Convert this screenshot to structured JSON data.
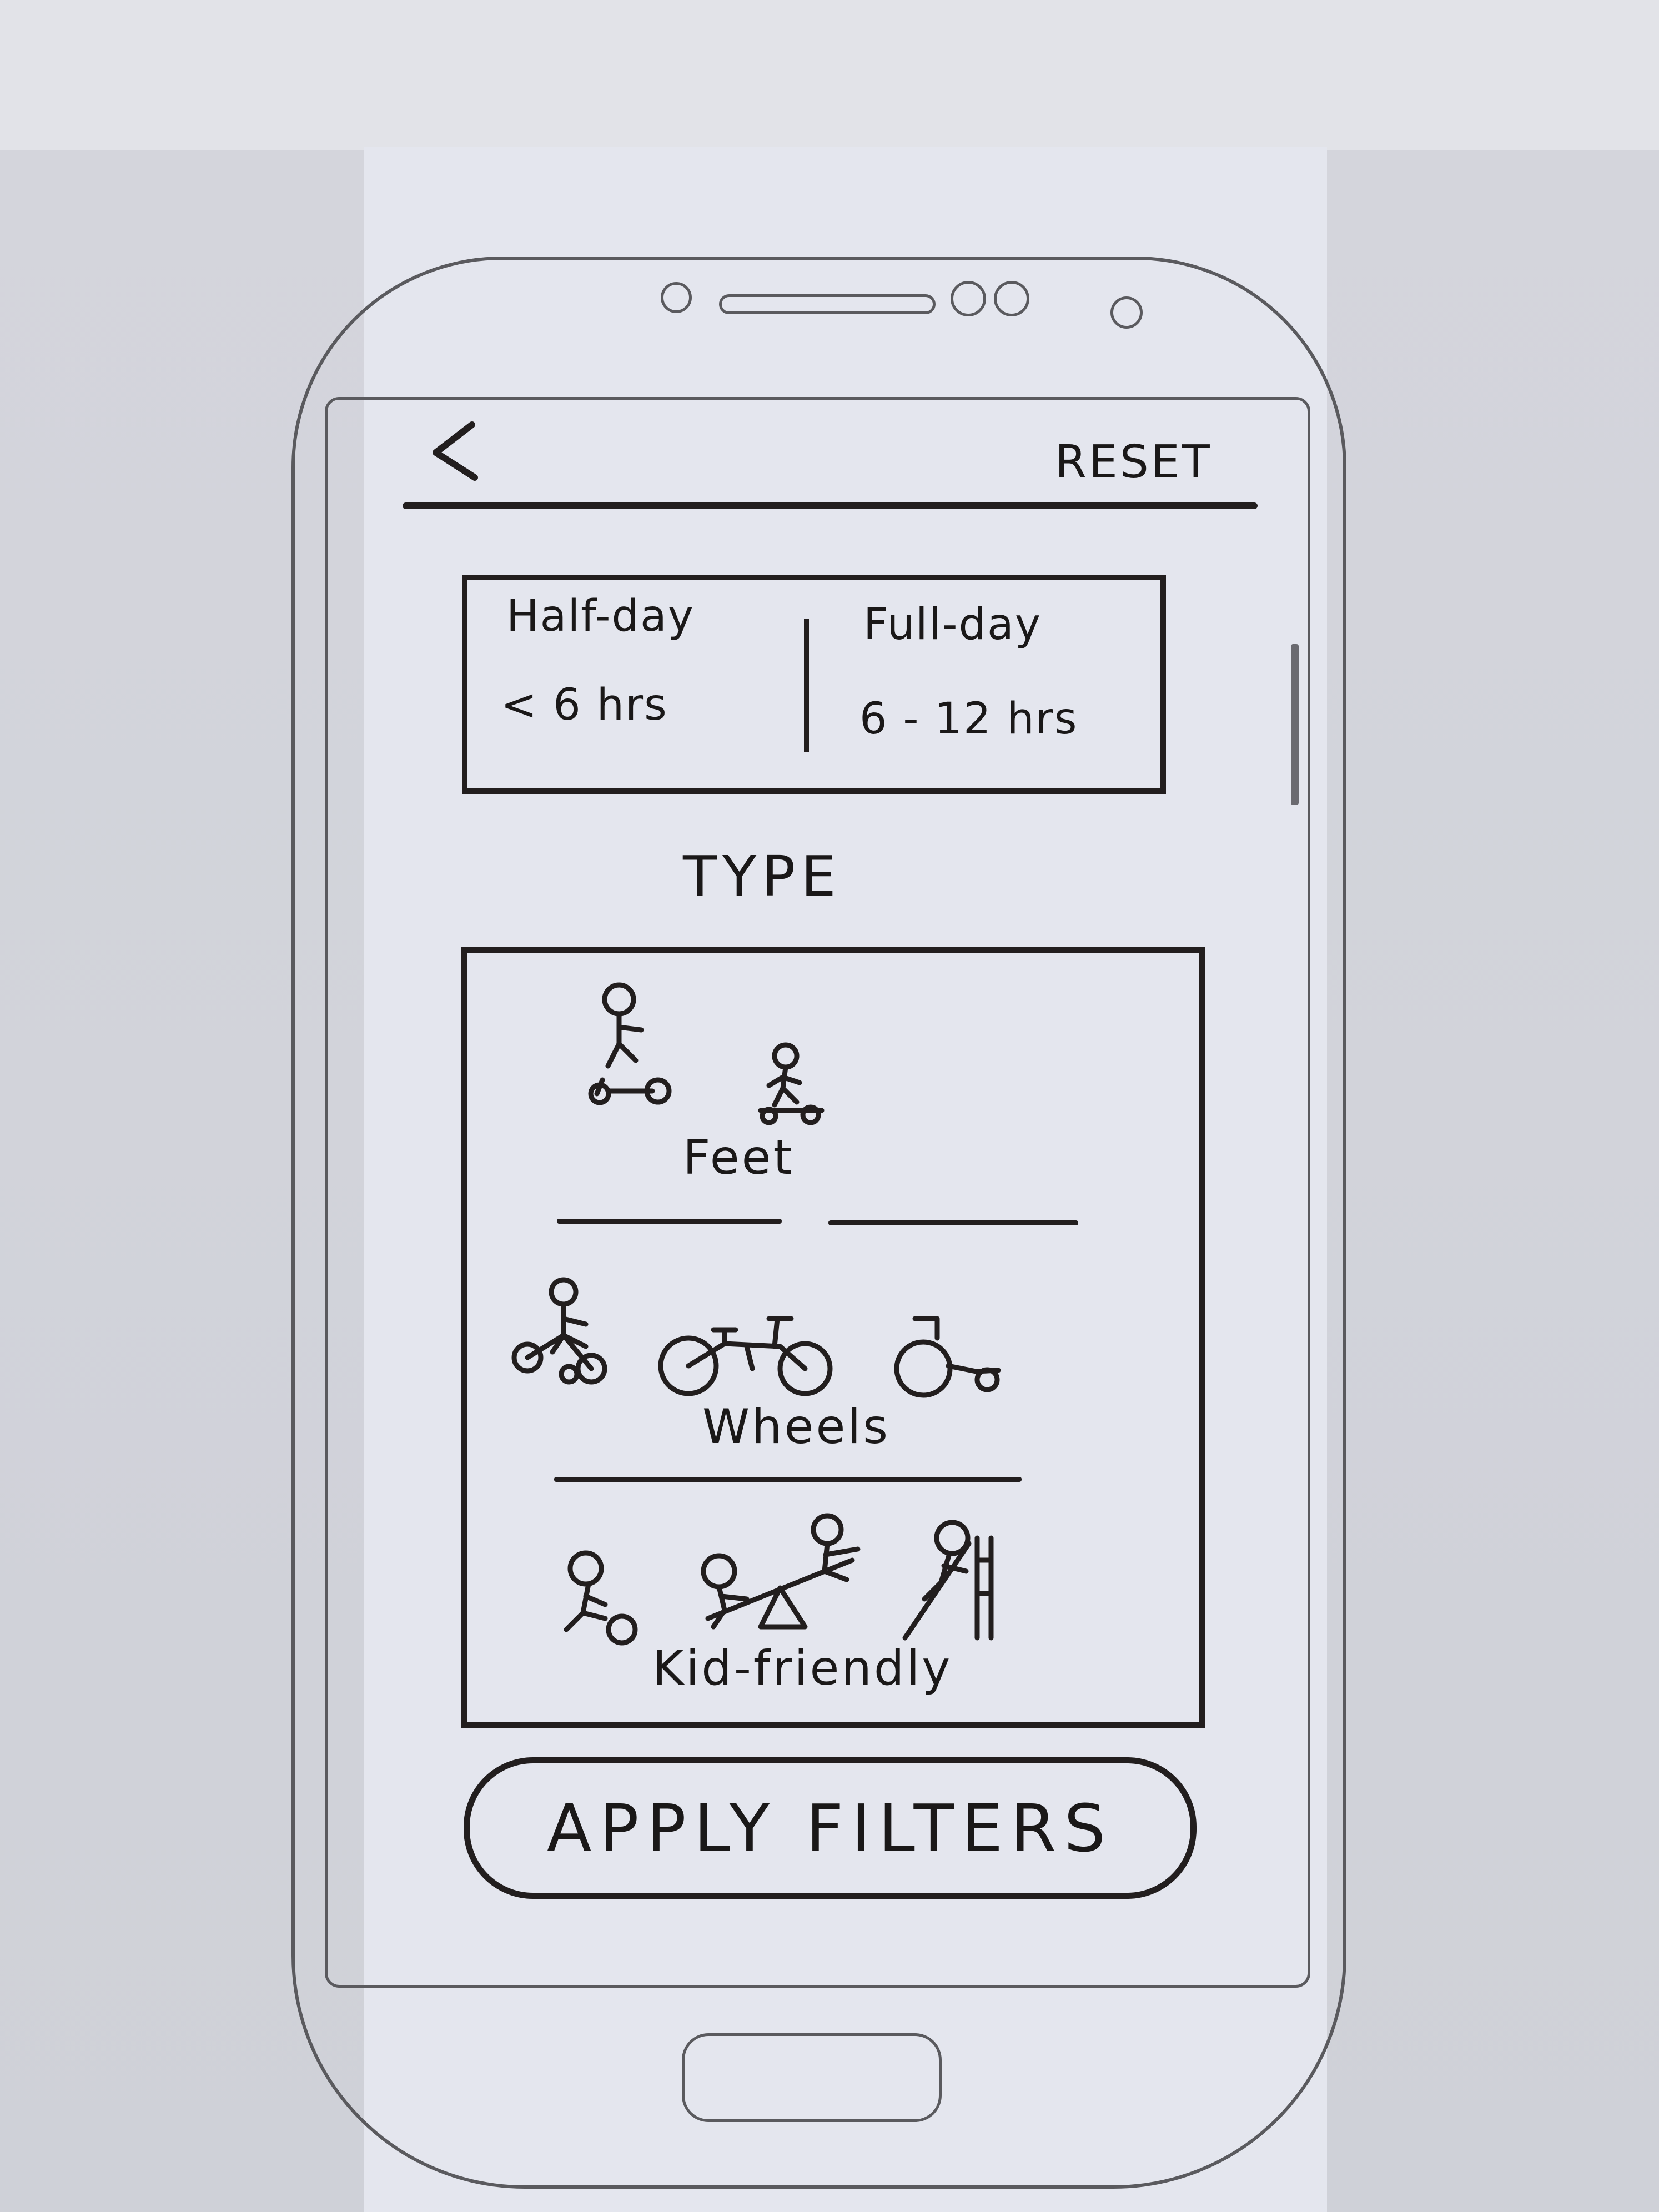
{
  "header": {
    "reset_label": "RESET"
  },
  "duration": {
    "options": [
      {
        "title": "Half-day",
        "detail": "< 6 hrs"
      },
      {
        "title": "Full-day",
        "detail": "6 - 12 hrs"
      }
    ]
  },
  "type_section": {
    "heading": "TYPE",
    "categories": [
      {
        "label": "Feet",
        "icons": [
          "scooter-rider-icon",
          "skater-icon"
        ]
      },
      {
        "label": "Wheels",
        "icons": [
          "tricycle-rider-icon",
          "bicycle-icon",
          "wheelchair-icon"
        ]
      },
      {
        "label": "Kid-friendly",
        "icons": [
          "kid-ball-icon",
          "seesaw-icon",
          "slide-icon"
        ]
      }
    ]
  },
  "footer": {
    "apply_label": "APPLY FILTERS"
  }
}
